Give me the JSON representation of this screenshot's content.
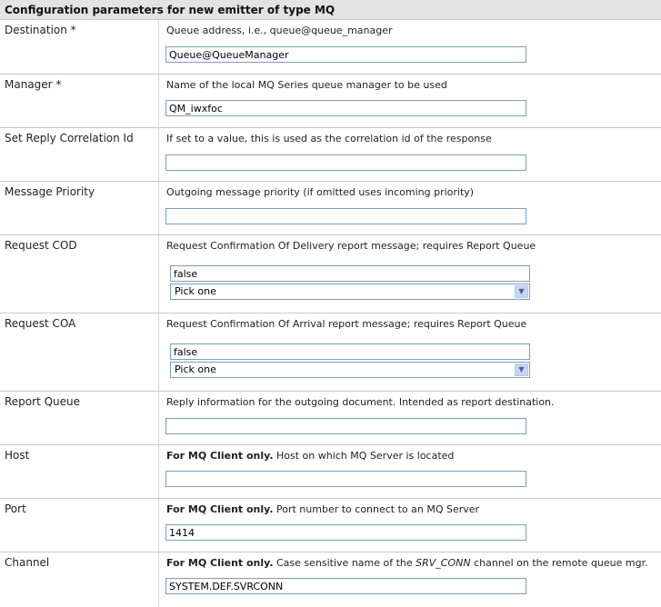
{
  "header": {
    "title": "Configuration parameters for new emitter of type MQ"
  },
  "rows": {
    "destination": {
      "label": "Destination *",
      "desc": "Queue address, i.e., queue@queue_manager",
      "value": "Queue@QueueManager"
    },
    "manager": {
      "label": "Manager *",
      "desc": "Name of the local MQ Series queue manager to be used",
      "value": "QM_iwxfoc"
    },
    "reply_correlation": {
      "label": "Set Reply Correlation Id",
      "desc": "If set to a value, this is used as the correlation id of the response",
      "value": ""
    },
    "priority": {
      "label": "Message Priority",
      "desc": "Outgoing message priority (if omitted uses incoming priority)",
      "value": ""
    },
    "cod": {
      "label": "Request COD",
      "desc": "Request Confirmation Of Delivery report message; requires Report Queue",
      "value": "false",
      "select": "Pick one"
    },
    "coa": {
      "label": "Request COA",
      "desc": "Request Confirmation Of Arrival report message; requires Report Queue",
      "value": "false",
      "select": "Pick one"
    },
    "report_queue": {
      "label": "Report Queue",
      "desc": "Reply information for the outgoing document. Intended as report destination.",
      "value": ""
    },
    "host": {
      "label": "Host",
      "desc_bold": "For MQ Client only.",
      "desc": " Host on which MQ Server is located",
      "value": ""
    },
    "port": {
      "label": "Port",
      "desc_bold": "For MQ Client only.",
      "desc": " Port number to connect to an MQ Server",
      "value": "1414"
    },
    "channel": {
      "label": "Channel",
      "desc_bold": "For MQ Client only.",
      "desc_pre": " Case sensitive name of the ",
      "desc_italic": "SRV_CONN",
      "desc_post": " channel on the remote queue mgr.",
      "value": "SYSTEM.DEF.SVRCONN"
    }
  },
  "icons": {
    "dropdown": "chevron-down-icon"
  }
}
